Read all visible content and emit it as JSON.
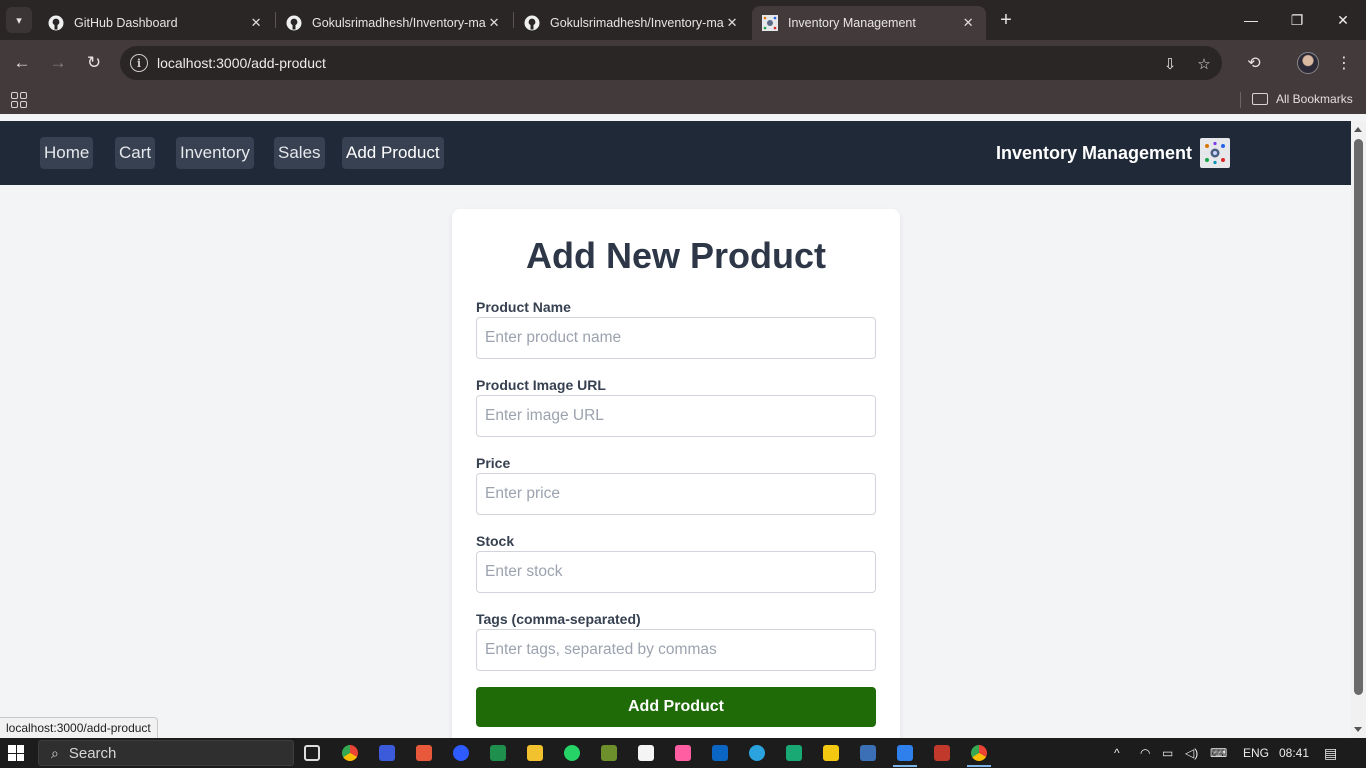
{
  "browser": {
    "tabs": [
      {
        "title": "GitHub Dashboard",
        "icon": "github-icon",
        "active": false
      },
      {
        "title": "Gokulsrimadhesh/Inventory-ma",
        "icon": "github-icon",
        "active": false
      },
      {
        "title": "Gokulsrimadhesh/Inventory-ma",
        "icon": "github-icon",
        "active": false
      },
      {
        "title": "Inventory Management",
        "icon": "app-favicon",
        "active": true
      }
    ],
    "url": "localhost:3000/add-product",
    "bookmarks_label": "All Bookmarks",
    "status_url": "localhost:3000/add-product"
  },
  "app": {
    "nav": [
      {
        "label": "Home"
      },
      {
        "label": "Cart"
      },
      {
        "label": "Inventory"
      },
      {
        "label": "Sales"
      },
      {
        "label": "Add Product",
        "active": true
      }
    ],
    "brand": "Inventory Management"
  },
  "form": {
    "title": "Add New Product",
    "fields": [
      {
        "label": "Product Name",
        "placeholder": "Enter product name",
        "value": ""
      },
      {
        "label": "Product Image URL",
        "placeholder": "Enter image URL",
        "value": ""
      },
      {
        "label": "Price",
        "placeholder": "Enter price",
        "value": ""
      },
      {
        "label": "Stock",
        "placeholder": "Enter stock",
        "value": ""
      },
      {
        "label": "Tags (comma-separated)",
        "placeholder": "Enter tags, separated by commas",
        "value": ""
      }
    ],
    "submit_label": "Add Product"
  },
  "taskbar": {
    "search_label": "Search",
    "language": "ENG",
    "time": "08:41"
  },
  "colors": {
    "nav_bg": "#1f2937",
    "submit_bg": "#1e6b07",
    "page_bg": "#f3f4f6"
  }
}
